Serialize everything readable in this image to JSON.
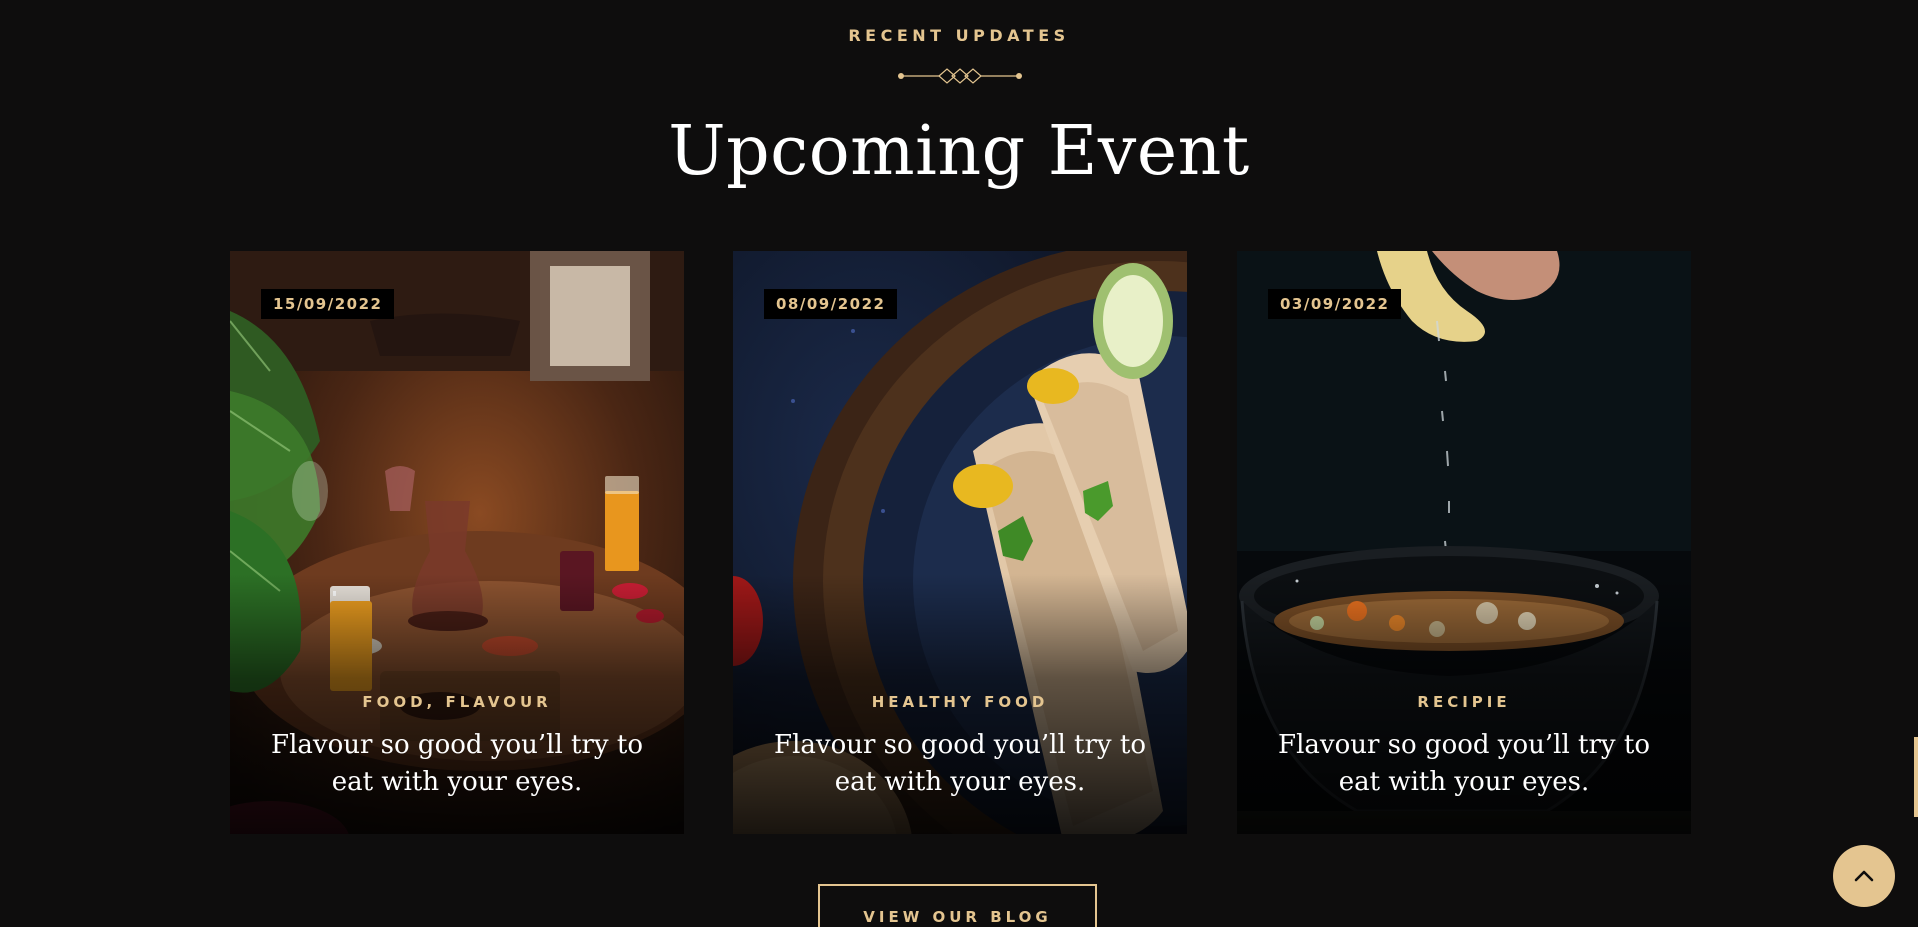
{
  "section": {
    "eyebrow": "RECENT UPDATES",
    "title": "Upcoming Event"
  },
  "cards": [
    {
      "date": "15/09/2022",
      "category": "FOOD, FLAVOUR",
      "title": "Flavour so good you’ll try to eat with your eyes.",
      "image": "restaurant-table-with-wine-and-dishes"
    },
    {
      "date": "08/09/2022",
      "category": "HEALTHY FOOD",
      "title": "Flavour so good you’ll try to eat with your eyes.",
      "image": "dosa-rolls-on-blue-plate"
    },
    {
      "date": "03/09/2022",
      "category": "RECIPIE",
      "title": "Flavour so good you’ll try to eat with your eyes.",
      "image": "lemon-squeezed-over-soup-bowl"
    }
  ],
  "actions": {
    "blog_button": "VIEW OUR BLOG",
    "back_to_top_icon": "chevron-up-icon"
  },
  "colors": {
    "background": "#0e0d0d",
    "accent": "#e4c590",
    "heading": "#ffffff"
  }
}
